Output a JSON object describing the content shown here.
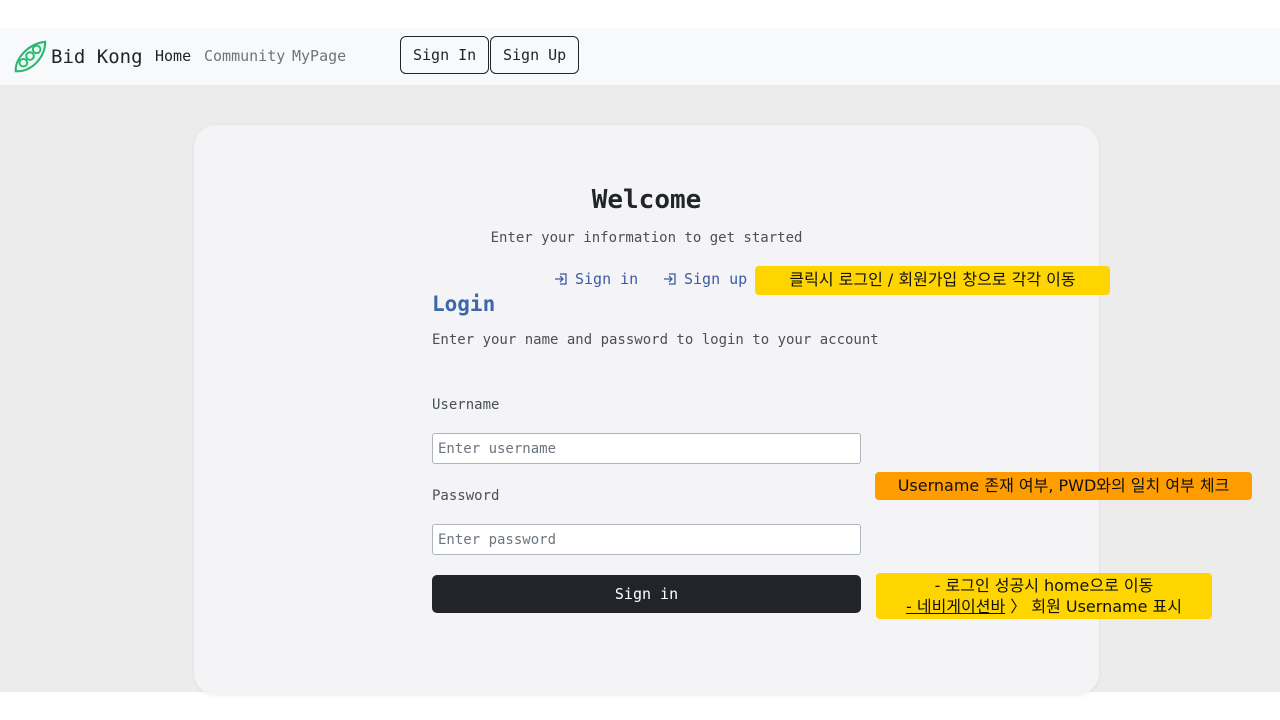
{
  "navbar": {
    "brand": "Bid Kong",
    "links": [
      "Home",
      "Community",
      "MyPage"
    ],
    "sign_in_button": "Sign In",
    "sign_up_button": "Sign Up"
  },
  "welcome": {
    "title": "Welcome",
    "subtitle": "Enter your information to get started",
    "tabs": [
      "Sign in",
      "Sign up"
    ]
  },
  "login": {
    "title": "Login",
    "description": "Enter your name and password to login to your account",
    "username_label": "Username",
    "username_placeholder": "Enter username",
    "password_label": "Password",
    "password_placeholder": "Enter password",
    "submit": "Sign in"
  },
  "annotations": {
    "tabs_note": "클릭시 로그인 / 회원가입 창으로 각각 이동",
    "validation_note": "Username 존재 여부, PWD와의 일치 여부 체크",
    "success_line1": "- 로그인 성공시 home으로 이동",
    "success_line2_underlined": "- 네비게이션바",
    "success_line2_rest": " 〉 회원 Username 표시"
  },
  "colors": {
    "accent_blue": "#3f66a8",
    "dark_button": "#212529",
    "note_yellow": "#ffd500",
    "note_orange": "#ff9d00",
    "logo_green": "#2bb673"
  }
}
